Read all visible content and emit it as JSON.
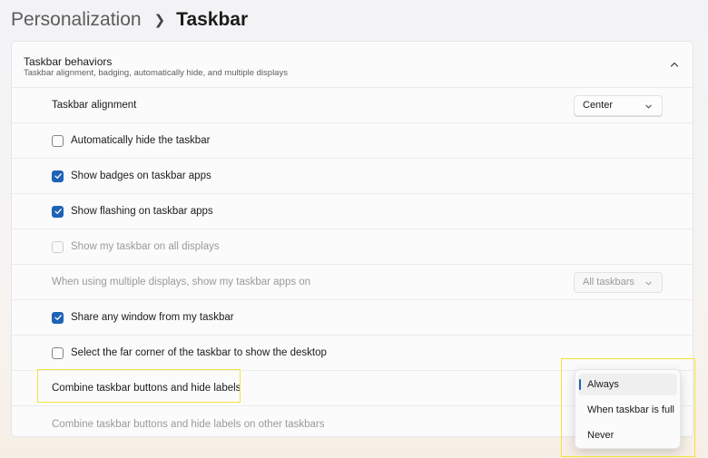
{
  "breadcrumb": {
    "parent": "Personalization",
    "current": "Taskbar"
  },
  "section": {
    "title": "Taskbar behaviors",
    "subtitle": "Taskbar alignment, badging, automatically hide, and multiple displays"
  },
  "settings": {
    "alignment": {
      "label": "Taskbar alignment",
      "value": "Center"
    },
    "auto_hide": {
      "label": "Automatically hide the taskbar",
      "checked": false
    },
    "badges": {
      "label": "Show badges on taskbar apps",
      "checked": true
    },
    "flashing": {
      "label": "Show flashing on taskbar apps",
      "checked": true
    },
    "all_displays": {
      "label": "Show my taskbar on all displays",
      "checked": false,
      "disabled": true
    },
    "multi_display": {
      "label": "When using multiple displays, show my taskbar apps on",
      "value": "All taskbars",
      "disabled": true
    },
    "share_window": {
      "label": "Share any window from my taskbar",
      "checked": true
    },
    "far_corner": {
      "label": "Select the far corner of the taskbar to show the desktop",
      "checked": false
    },
    "combine": {
      "label": "Combine taskbar buttons and hide labels"
    },
    "combine_other": {
      "label": "Combine taskbar buttons and hide labels on other taskbars",
      "disabled": true
    }
  },
  "combine_menu": {
    "options": [
      "Always",
      "When taskbar is full",
      "Never"
    ],
    "selected": "Always"
  },
  "colors": {
    "accent": "#1e63b6",
    "highlight": "#f5e23a"
  }
}
